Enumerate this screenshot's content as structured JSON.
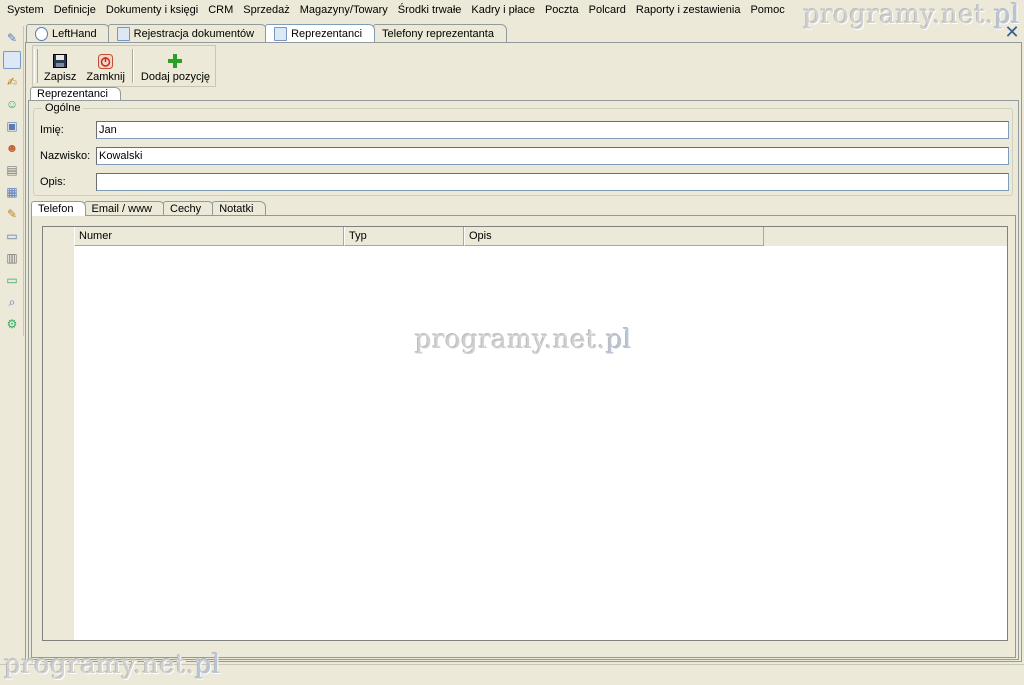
{
  "menu": [
    "System",
    "Definicje",
    "Dokumenty i księgi",
    "CRM",
    "Sprzedaż",
    "Magazyny/Towary",
    "Środki trwałe",
    "Kadry i płace",
    "Poczta",
    "Polcard",
    "Raporty i zestawienia",
    "Pomoc"
  ],
  "watermark": {
    "text": "programy.net.",
    "suffix": "pl"
  },
  "doc_tabs": [
    {
      "label": "LeftHand",
      "icon": "lefthand-logo-icon",
      "active": false
    },
    {
      "label": "Rejestracja dokumentów",
      "icon": "document-icon",
      "active": false
    },
    {
      "label": "Reprezentanci",
      "icon": "document-icon",
      "active": true
    },
    {
      "label": "Telefony reprezentanta",
      "icon": "",
      "active": false
    }
  ],
  "toolbar": {
    "save_label": "Zapisz",
    "close_label": "Zamknij",
    "add_label": "Dodaj pozycję"
  },
  "subtab": {
    "label": "Reprezentanci"
  },
  "group": {
    "legend": "Ogólne",
    "first_name_label": "Imię:",
    "first_name_value": "Jan",
    "last_name_label": "Nazwisko:",
    "last_name_value": "Kowalski",
    "desc_label": "Opis:",
    "desc_value": ""
  },
  "inner_tabs": [
    "Telefon",
    "Email / www",
    "Cechy",
    "Notatki"
  ],
  "grid": {
    "columns": [
      "Numer",
      "Typ",
      "Opis"
    ]
  },
  "colors": {
    "accent": "#7f9db9",
    "background": "#ece9d8"
  }
}
